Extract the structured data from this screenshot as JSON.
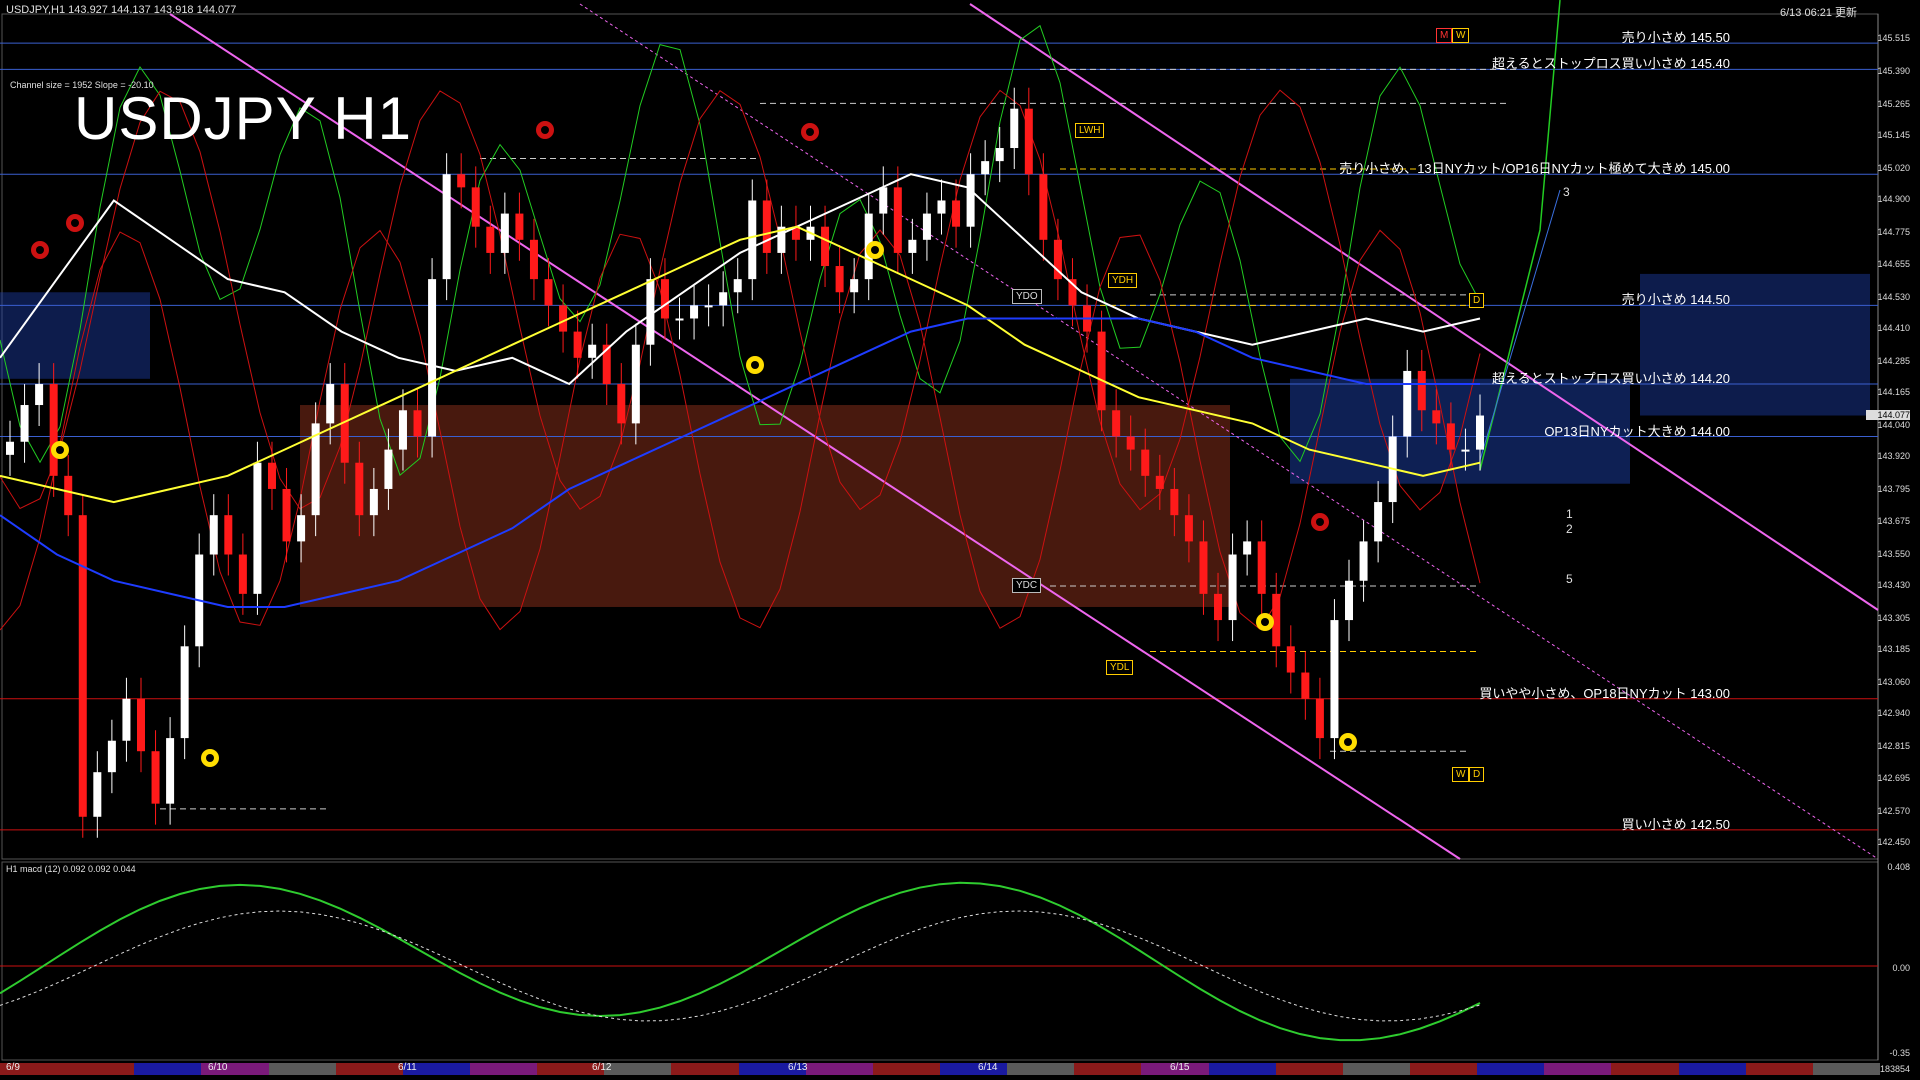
{
  "header": {
    "symbol_info": "USDJPY,H1  143.927 144.137 143.918 144.077",
    "datetime": "6/13 06:21 更新",
    "channel_info": "Channel size = 1952 Slope = -20.10",
    "title": "USDJPY H1"
  },
  "price_axis": {
    "labels": [
      "145.515",
      "145.390",
      "145.265",
      "145.145",
      "145.020",
      "144.900",
      "144.775",
      "144.655",
      "144.530",
      "144.410",
      "144.285",
      "144.165",
      "144.040",
      "143.920",
      "143.795",
      "143.675",
      "143.550",
      "143.430",
      "143.305",
      "143.185",
      "143.060",
      "142.940",
      "142.815",
      "142.695",
      "142.570",
      "142.450"
    ],
    "current": "144.077"
  },
  "annotations": [
    {
      "price": 145.5,
      "text": "売り小さめ 145.50"
    },
    {
      "price": 145.4,
      "text": "超えるとストップロス買い小さめ 145.40"
    },
    {
      "price": 145.0,
      "text": "売り小さめ、13日NYカット/OP16日NYカット極めて大きめ 145.00"
    },
    {
      "price": 144.5,
      "text": "売り小さめ 144.50"
    },
    {
      "price": 144.2,
      "text": "超えるとストップロス買い小さめ 144.20"
    },
    {
      "price": 144.0,
      "text": "OP13日NYカット大きめ 144.00"
    },
    {
      "price": 143.0,
      "text": "買いやや小さめ、OP18日NYカット 143.00"
    },
    {
      "price": 142.5,
      "text": "買い小さめ 142.50"
    }
  ],
  "markers": {
    "lwh": "LWH",
    "ydh": "YDH",
    "ydo": "YDO",
    "ydc": "YDC",
    "ydl": "YDL",
    "m": "M",
    "w": "W",
    "d": "D"
  },
  "wave_labels": [
    "3",
    "1",
    "2",
    "5"
  ],
  "macd": {
    "label": "H1  macd (12) 0.092 0.092 0.044",
    "axis": [
      "0.408",
      "0.00",
      "-0.35"
    ],
    "bottom": "183854"
  },
  "date_labels": [
    "6/9",
    "6/10",
    "6/11",
    "6/12",
    "6/13",
    "6/14",
    "6/15"
  ],
  "colors": {
    "up": "#ffffff",
    "down": "#ff1a1a",
    "ma_white": "#ffffff",
    "ma_yellow": "#ffff33",
    "ma_blue": "#1e3cff",
    "channel": "#ee66ee",
    "hline": "#3a5fd0",
    "support": "#cc1111",
    "green": "#22cc22"
  },
  "chart_data": {
    "type": "line",
    "title": "USDJPY H1",
    "ylim": [
      142.45,
      145.55
    ],
    "candles_close": [
      143.98,
      144.12,
      144.2,
      143.85,
      143.7,
      142.55,
      142.72,
      142.84,
      143.0,
      142.8,
      142.6,
      142.85,
      143.2,
      143.55,
      143.7,
      143.55,
      143.4,
      143.9,
      143.8,
      143.6,
      143.7,
      144.05,
      144.2,
      143.9,
      143.7,
      143.8,
      143.95,
      144.1,
      144.0,
      144.6,
      145.0,
      144.95,
      144.8,
      144.7,
      144.85,
      144.75,
      144.6,
      144.5,
      144.4,
      144.3,
      144.35,
      144.2,
      144.05,
      144.35,
      144.6,
      144.45,
      144.45,
      144.5,
      144.5,
      144.55,
      144.6,
      144.9,
      144.7,
      144.8,
      144.75,
      144.8,
      144.65,
      144.55,
      144.6,
      144.85,
      144.95,
      144.7,
      144.75,
      144.85,
      144.9,
      144.8,
      145.0,
      145.05,
      145.1,
      145.25,
      145.0,
      144.75,
      144.6,
      144.5,
      144.4,
      144.1,
      144.0,
      143.95,
      143.85,
      143.8,
      143.7,
      143.6,
      143.4,
      143.3,
      143.55,
      143.6,
      143.4,
      143.2,
      143.1,
      143.0,
      142.85,
      143.3,
      143.45,
      143.6,
      143.75,
      144.0,
      144.25,
      144.1,
      144.05,
      143.95,
      143.95,
      144.08
    ],
    "series": [
      {
        "values": [
          144.3,
          144.6,
          144.9,
          144.75,
          144.6,
          144.55,
          144.4,
          144.3,
          144.25,
          144.3,
          144.2,
          144.4,
          144.55,
          144.7,
          144.8,
          144.9,
          145.0,
          144.95,
          144.75,
          144.55,
          144.45,
          144.4,
          144.35,
          144.4,
          144.45,
          144.4,
          144.45
        ]
      },
      {
        "values": [
          143.85,
          143.8,
          143.75,
          143.8,
          143.85,
          143.95,
          144.05,
          144.15,
          144.25,
          144.35,
          144.45,
          144.55,
          144.65,
          144.75,
          144.8,
          144.7,
          144.6,
          144.5,
          144.35,
          144.25,
          144.15,
          144.1,
          144.05,
          143.95,
          143.9,
          143.85,
          143.9
        ]
      },
      {
        "values": [
          143.7,
          143.55,
          143.45,
          143.4,
          143.35,
          143.35,
          143.4,
          143.45,
          143.55,
          143.65,
          143.8,
          143.9,
          144.0,
          144.1,
          144.2,
          144.3,
          144.4,
          144.45,
          144.45,
          144.45,
          144.45,
          144.4,
          144.3,
          144.25,
          144.2,
          144.2,
          144.2
        ]
      }
    ],
    "channel_slope": -20.1,
    "grid": false
  }
}
